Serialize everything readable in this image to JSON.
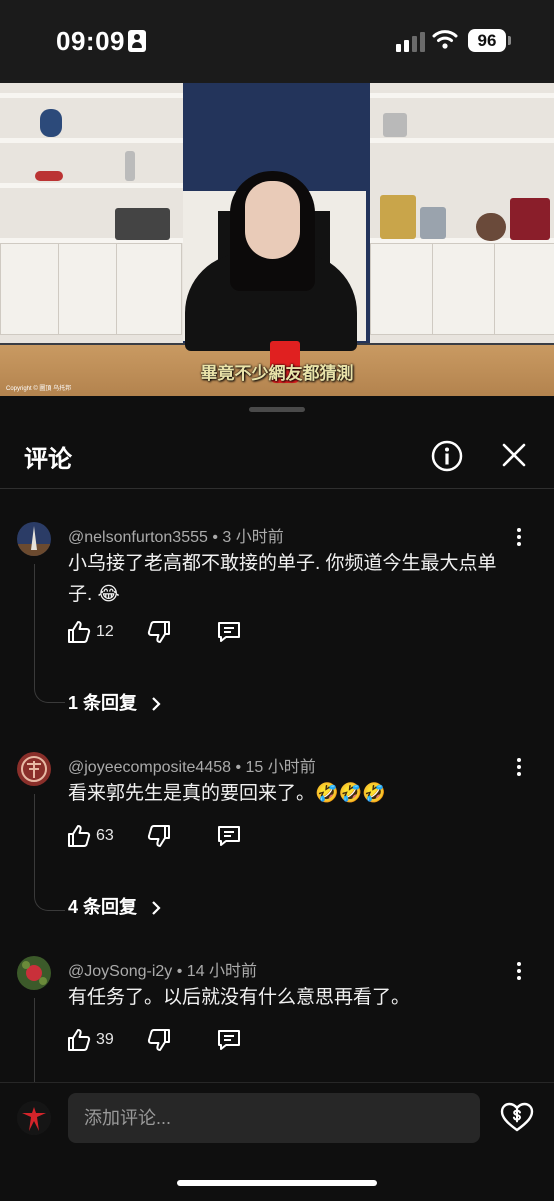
{
  "status_bar": {
    "time": "09:09",
    "battery": "96"
  },
  "video": {
    "subtitle": "畢竟不少網友都猜測",
    "copyright": "Copyright © 圖頂 乌托邦"
  },
  "comments_panel": {
    "title": "评论",
    "info_icon": "info-icon",
    "close_icon": "close-icon"
  },
  "comments": [
    {
      "author": "@nelsonfurton3555",
      "time": "3 小时前",
      "text": "小乌接了老高都不敢接的单子. 你频道今生最大点单子. 😂",
      "likes": "12",
      "replies": "1 条回复"
    },
    {
      "author": "@joyeecomposite4458",
      "time": "15 小时前",
      "text": "看来郭先生是真的要回来了。🤣🤣🤣",
      "likes": "63",
      "replies": "4 条回复"
    },
    {
      "author": "@JoySong-i2y",
      "time": "14 小时前",
      "text": "有任务了。以后就没有什么意思再看了。",
      "likes": "39"
    }
  ],
  "composer": {
    "placeholder": "添加评论..."
  },
  "colors": {
    "background": "#0f0f0f",
    "input_bg": "#272727",
    "meta_text": "#aaaaaa",
    "mug_red": "#e02020"
  }
}
